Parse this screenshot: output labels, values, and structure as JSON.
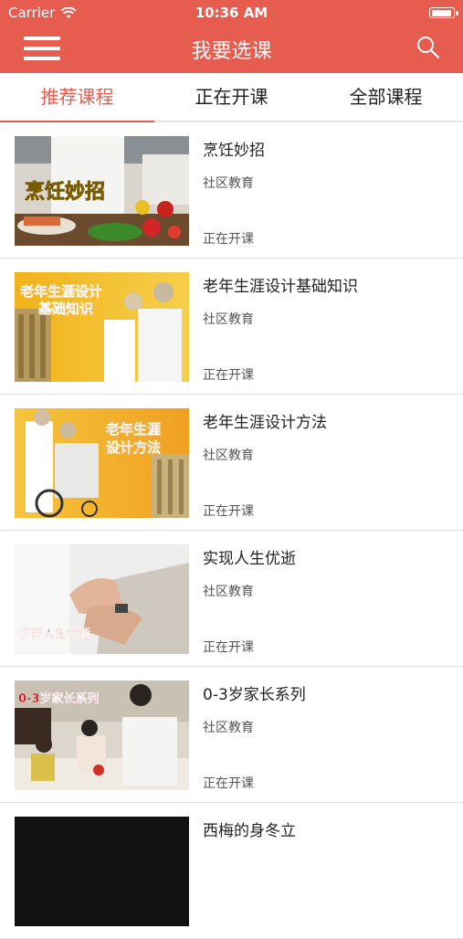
{
  "status_bar": {
    "carrier": "Carrier",
    "time": "10:36 AM"
  },
  "nav": {
    "title": "我要选课"
  },
  "tabs": [
    {
      "label": "推荐课程",
      "active": true
    },
    {
      "label": "正在开课",
      "active": false
    },
    {
      "label": "全部课程",
      "active": false
    }
  ],
  "courses": [
    {
      "title": "烹饪妙招",
      "category": "社区教育",
      "status": "正在开课",
      "thumb_text": "烹饪妙招"
    },
    {
      "title": "老年生涯设计基础知识",
      "category": "社区教育",
      "status": "正在开课",
      "thumb_text_1": "老年生涯设计",
      "thumb_text_2": "基础知识"
    },
    {
      "title": "老年生涯设计方法",
      "category": "社区教育",
      "status": "正在开课",
      "thumb_text_1": "老年生涯",
      "thumb_text_2": "设计方法"
    },
    {
      "title": "实现人生优逝",
      "category": "社区教育",
      "status": "正在开课",
      "thumb_text": "实现人生优逝"
    },
    {
      "title": "0-3岁家长系列",
      "category": "社区教育",
      "status": "正在开课",
      "thumb_text": "0-3岁家长系列"
    },
    {
      "title": "西梅的身冬立",
      "category": "",
      "status": ""
    }
  ],
  "colors": {
    "accent": "#e65c4f",
    "header_bg": "#e65c4f"
  },
  "icons": {
    "menu": "hamburger-icon",
    "search": "search-icon",
    "wifi": "wifi-icon",
    "battery": "battery-icon"
  }
}
